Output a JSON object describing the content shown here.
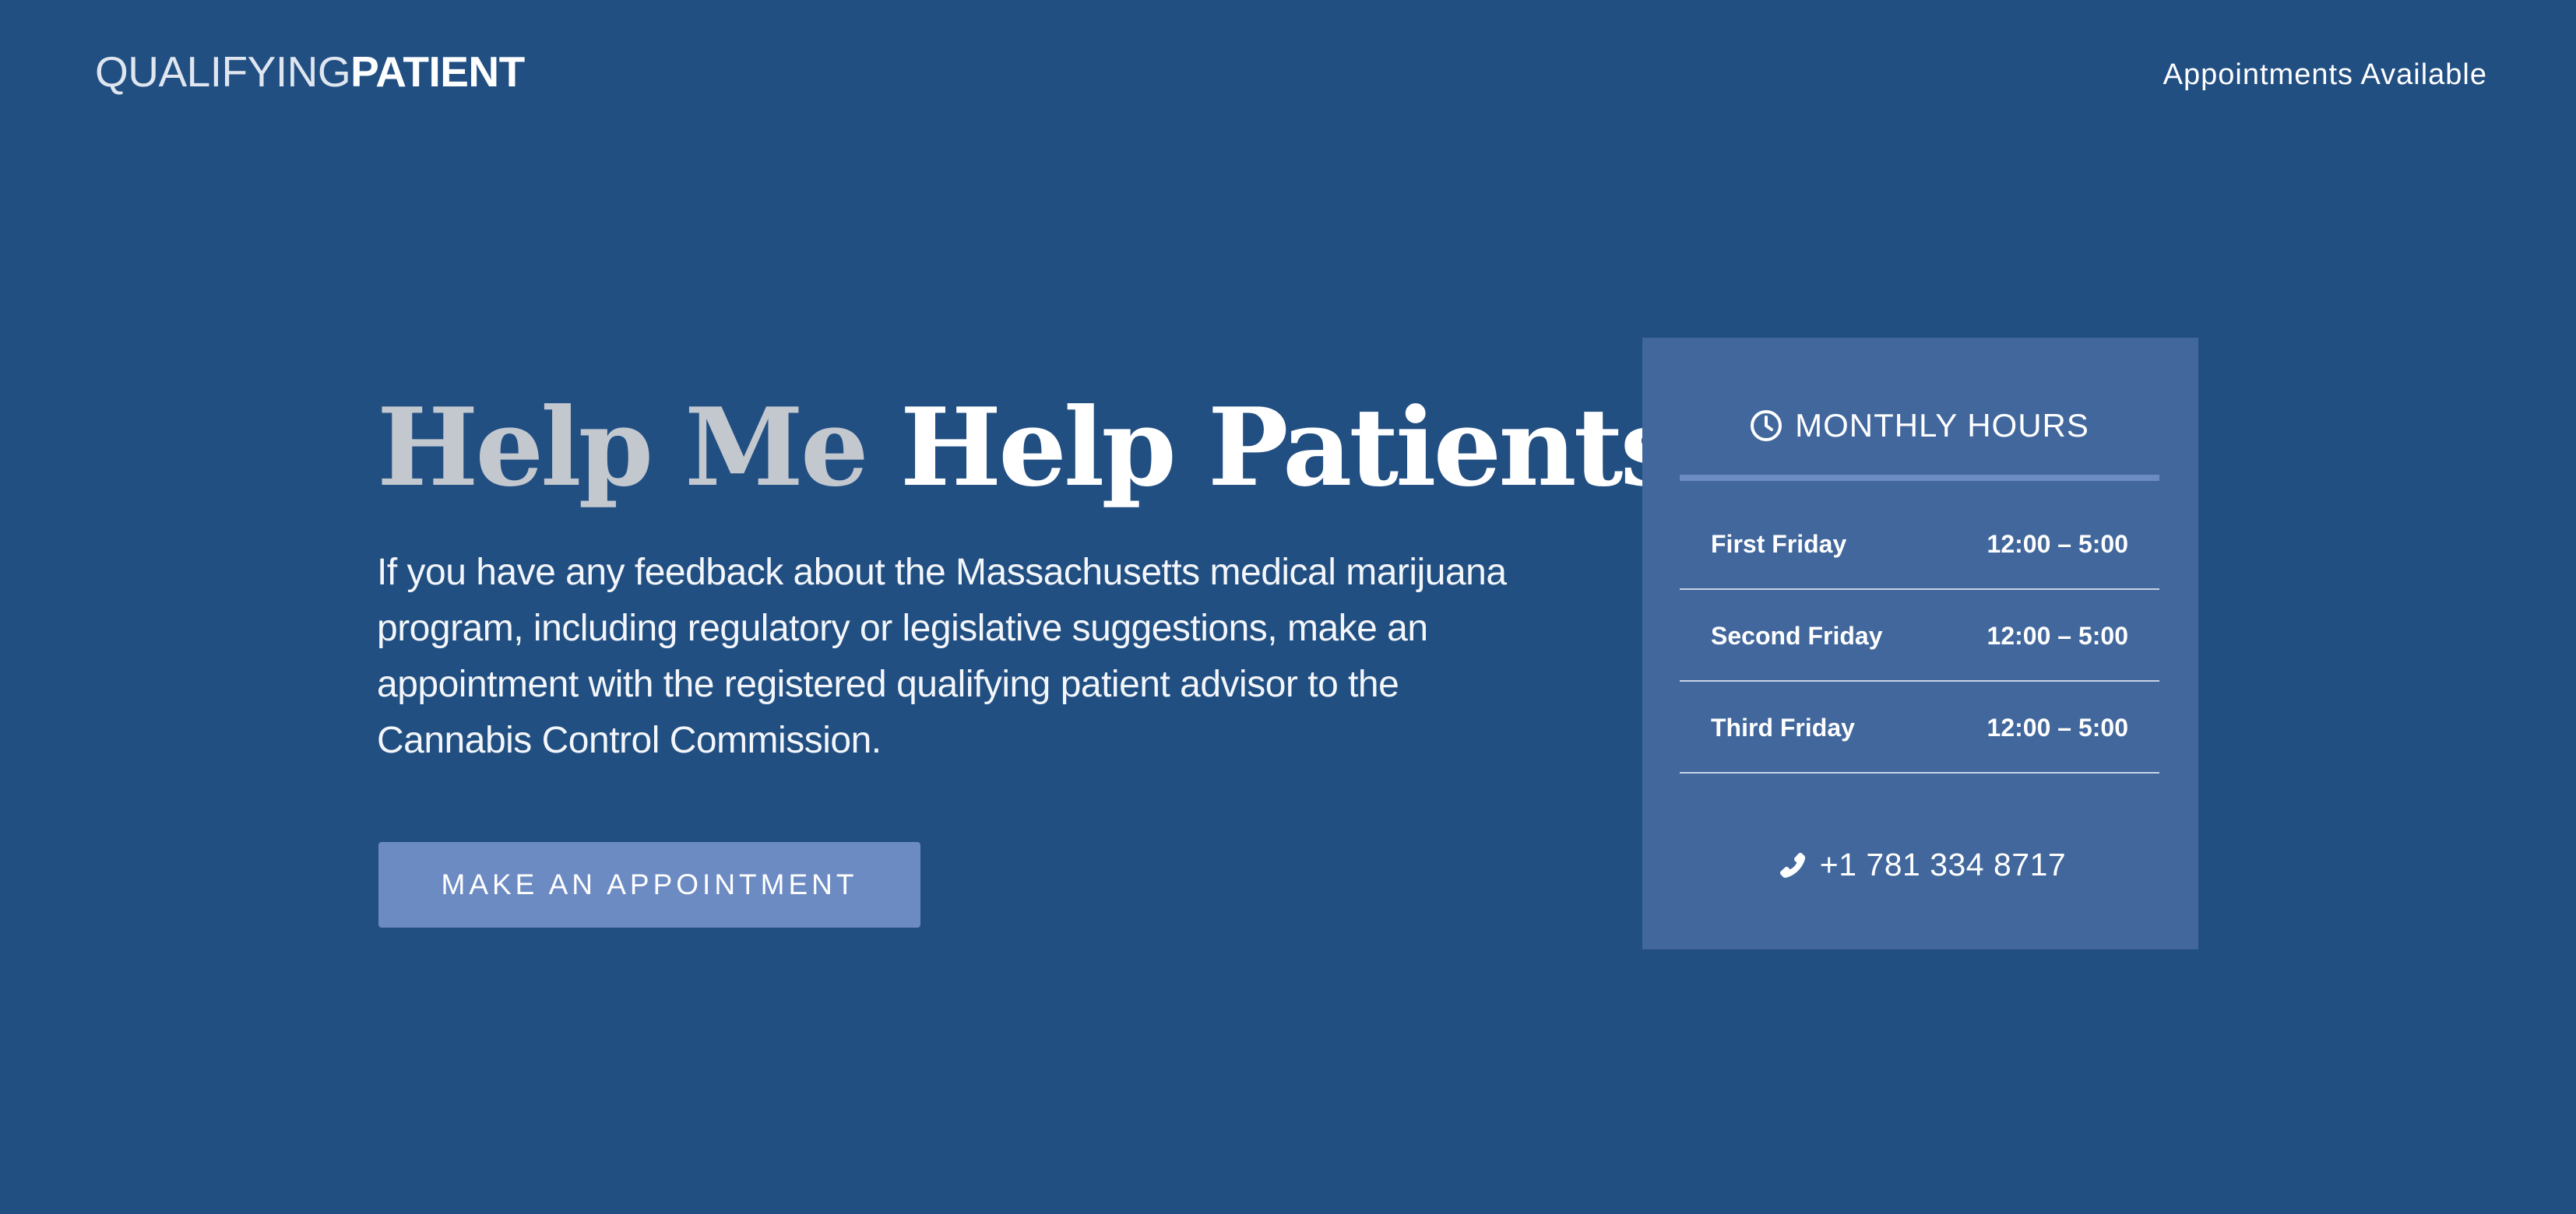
{
  "header": {
    "logo_light": "QUALIFYING",
    "logo_bold": "PATIENT",
    "nav_link": "Appointments Available"
  },
  "hero": {
    "title_grey": "Help Me",
    "title_white": "Help Patients",
    "intro": "If you have any feedback about the Massachusetts medical marijuana program, including regulatory or legislative suggestions, make an appointment with the registered qualifying patient advisor to the Cannabis Control Commission.",
    "cta_label": "MAKE AN APPOINTMENT"
  },
  "hours": {
    "title": "MONTHLY HOURS",
    "icon": "clock-icon",
    "rows": [
      {
        "day": "First Friday",
        "time": "12:00 – 5:00"
      },
      {
        "day": "Second Friday",
        "time": "12:00 – 5:00"
      },
      {
        "day": "Third Friday",
        "time": "12:00 – 5:00"
      }
    ],
    "phone_icon": "phone-icon",
    "phone": "+1 781 334 8717"
  },
  "colors": {
    "background": "#224f82",
    "card": "#41679c",
    "accent": "#6d8bc3",
    "headline_grey": "#c3c8cf"
  }
}
